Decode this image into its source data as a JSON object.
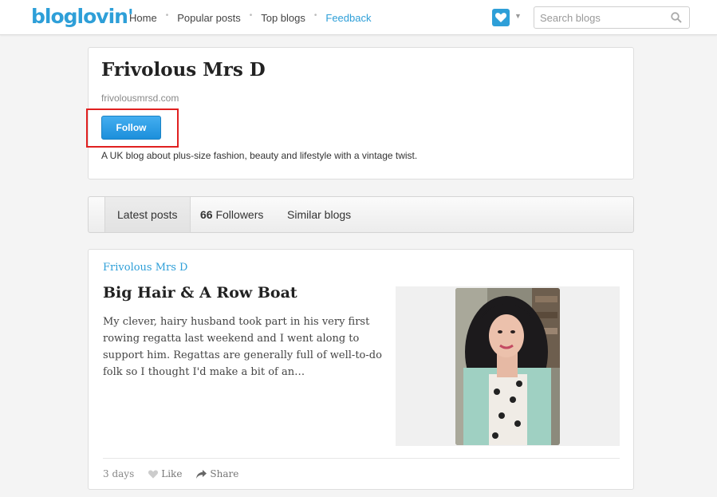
{
  "header": {
    "logo": "bloglovin'",
    "nav": [
      "Home",
      "Popular posts",
      "Top blogs"
    ],
    "feedback": "Feedback",
    "search_placeholder": "Search blogs",
    "search_value": ""
  },
  "blog": {
    "title": "Frivolous Mrs D",
    "url": "frivolousmrsd.com",
    "follow_label": "Follow",
    "description": "A UK blog about plus-size fashion, beauty and lifestyle with a vintage twist."
  },
  "tabs": {
    "latest": "Latest posts",
    "followers_count": "66",
    "followers_label": "Followers",
    "similar": "Similar blogs"
  },
  "post": {
    "blog_name": "Frivolous Mrs D",
    "title": "Big Hair & A Row Boat",
    "excerpt": "My clever, hairy husband took part in his very first rowing regatta last weekend and I went along to support him. Regattas are generally full of well-to-do folk so I thought I'd make a bit of an…",
    "age": "3 days",
    "like_label": "Like",
    "share_label": "Share"
  },
  "colors": {
    "brand": "#2e9fd8",
    "highlight_frame": "#e02020"
  },
  "icons": [
    "heart-icon",
    "chevron-down-icon",
    "search-icon",
    "like-heart-icon",
    "share-arrow-icon"
  ]
}
